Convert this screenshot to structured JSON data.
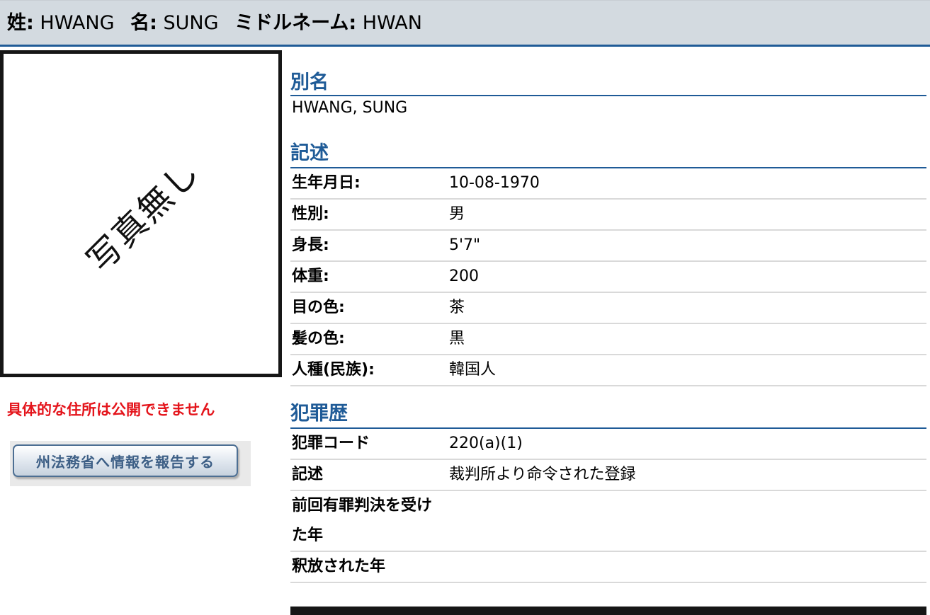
{
  "header": {
    "last_name_label": "姓:",
    "last_name": "HWANG",
    "first_name_label": "名:",
    "first_name": "SUNG",
    "middle_name_label": "ミドルネーム:",
    "middle_name": "HWAN"
  },
  "photo": {
    "placeholder_text": "写真無し"
  },
  "address_notice": "具体的な住所は公開できません",
  "report_button": {
    "label": "州法務省へ情報を報告する"
  },
  "aliases": {
    "title": "別名",
    "values": [
      "HWANG, SUNG"
    ]
  },
  "description": {
    "title": "記述",
    "rows": [
      {
        "label": "生年月日:",
        "value": "10-08-1970"
      },
      {
        "label": "性別:",
        "value": "男"
      },
      {
        "label": "身長:",
        "value": "5'7\""
      },
      {
        "label": "体重:",
        "value": "200"
      },
      {
        "label": "目の色:",
        "value": "茶"
      },
      {
        "label": "髪の色:",
        "value": "黒"
      },
      {
        "label": "人種(民族):",
        "value": "韓国人"
      }
    ]
  },
  "criminal_history": {
    "title": "犯罪歴",
    "rows": [
      {
        "label": "犯罪コード",
        "value": "220(a)(1)"
      },
      {
        "label": "記述",
        "value": "裁判所より命令された登録"
      },
      {
        "label": "前回有罪判決を受け た年",
        "value": ""
      },
      {
        "label": "釈放された年",
        "value": ""
      }
    ]
  },
  "colors": {
    "header_bg": "#d3dae0",
    "accent_blue": "#1f5b97",
    "notice_red": "#e4141b"
  }
}
